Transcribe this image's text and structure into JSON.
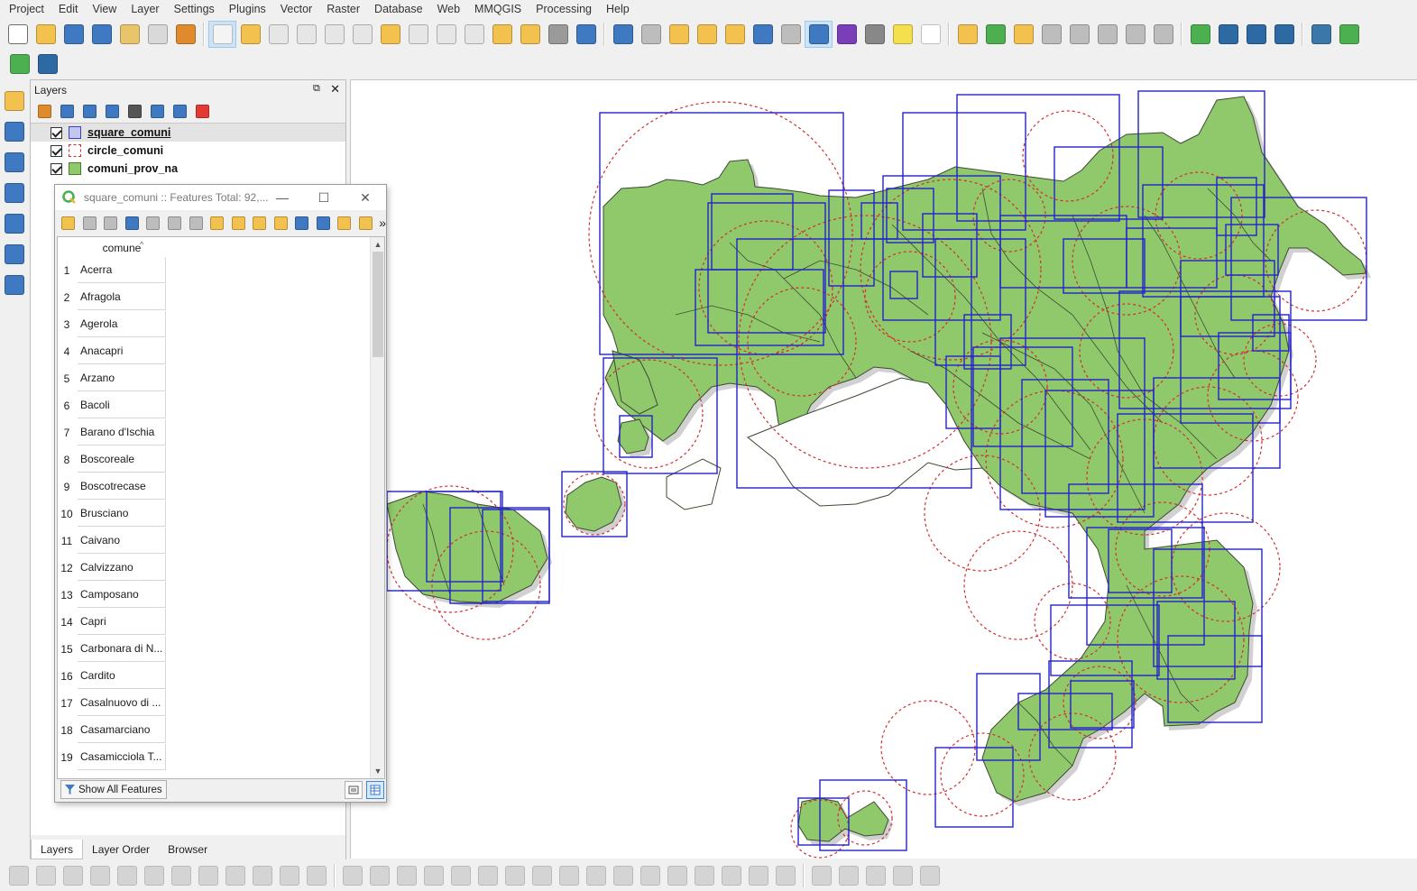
{
  "menubar": {
    "items": [
      "Project",
      "Edit",
      "View",
      "Layer",
      "Settings",
      "Plugins",
      "Vector",
      "Raster",
      "Database",
      "Web",
      "MMQGIS",
      "Processing",
      "Help"
    ]
  },
  "toolbar": {
    "icons": [
      {
        "name": "new-project-icon",
        "color": "#ffffff",
        "border": "#6d6d6d"
      },
      {
        "name": "open-project-icon",
        "color": "#f2c14e"
      },
      {
        "name": "save-project-icon",
        "color": "#3f79c2"
      },
      {
        "name": "save-as-icon",
        "color": "#3f79c2"
      },
      {
        "name": "new-print-layout-icon",
        "color": "#e9c46a"
      },
      {
        "name": "layout-manager-icon",
        "color": "#d9d9d9"
      },
      {
        "name": "style-manager-icon",
        "color": "#e08a2e"
      },
      {
        "sep": true
      },
      {
        "name": "pan-icon",
        "color": "#f4f4f4",
        "active": true
      },
      {
        "name": "pan-to-selection-icon",
        "color": "#f2c14e"
      },
      {
        "name": "zoom-in-icon",
        "color": "#e6e6e6"
      },
      {
        "name": "zoom-out-icon",
        "color": "#e6e6e6"
      },
      {
        "name": "zoom-native-icon",
        "color": "#e6e6e6"
      },
      {
        "name": "zoom-full-icon",
        "color": "#e6e6e6"
      },
      {
        "name": "zoom-to-selection-icon",
        "color": "#f2c14e"
      },
      {
        "name": "zoom-to-layer-icon",
        "color": "#e6e6e6"
      },
      {
        "name": "zoom-last-icon",
        "color": "#e6e6e6"
      },
      {
        "name": "zoom-next-icon",
        "color": "#e6e6e6"
      },
      {
        "name": "new-map-view-icon",
        "color": "#f2c14e"
      },
      {
        "name": "new-bookmark-icon",
        "color": "#f2c14e"
      },
      {
        "name": "show-bookmarks-icon",
        "color": "#9a9a9a"
      },
      {
        "name": "refresh-icon",
        "color": "#3f79c2"
      },
      {
        "sep": true
      },
      {
        "name": "identify-icon",
        "color": "#3f79c2"
      },
      {
        "name": "run-action-icon",
        "color": "#bdbdbd"
      },
      {
        "name": "select-features-icon",
        "color": "#f2c14e"
      },
      {
        "name": "select-by-value-icon",
        "color": "#f2c14e"
      },
      {
        "name": "deselect-all-icon",
        "color": "#f2c14e"
      },
      {
        "name": "open-attribute-table-icon",
        "color": "#3f79c2"
      },
      {
        "name": "field-calculator-icon",
        "color": "#bdbdbd"
      },
      {
        "name": "toolbox-icon",
        "color": "#3f79c2",
        "active": true
      },
      {
        "name": "statistical-summary-icon",
        "color": "#7a3fb8"
      },
      {
        "name": "measure-line-icon",
        "color": "#888888"
      },
      {
        "name": "map-tips-icon",
        "color": "#f4e04d"
      },
      {
        "name": "text-annotation-icon",
        "color": "#ffffff"
      },
      {
        "sep": true
      },
      {
        "name": "layer-labeling-icon",
        "color": "#f2c14e"
      },
      {
        "name": "layer-diagram-icon",
        "color": "#4caf50"
      },
      {
        "name": "highlight-pinned-labels-icon",
        "color": "#f2c14e"
      },
      {
        "name": "pin-label-icon",
        "color": "#bdbdbd"
      },
      {
        "name": "show-hide-labels-icon",
        "color": "#bdbdbd"
      },
      {
        "name": "move-label-icon",
        "color": "#bdbdbd"
      },
      {
        "name": "rotate-label-icon",
        "color": "#bdbdbd"
      },
      {
        "name": "change-label-icon",
        "color": "#bdbdbd"
      },
      {
        "sep": true
      },
      {
        "name": "geometry-checker-icon",
        "color": "#4caf50"
      },
      {
        "name": "quickmapservices-icon",
        "color": "#2d6aa3"
      },
      {
        "name": "web-search-icon",
        "color": "#2d6aa3"
      },
      {
        "name": "globe-cars-icon",
        "color": "#2d6aa3"
      },
      {
        "sep": true
      },
      {
        "name": "python-console-icon",
        "color": "#3b77a8"
      },
      {
        "name": "plugin-icon",
        "color": "#4caf50"
      }
    ]
  },
  "toolbar2": {
    "icons": [
      {
        "name": "search-locator-icon",
        "color": "#4caf50"
      },
      {
        "name": "processing-model-icon",
        "color": "#2d6aa3"
      }
    ]
  },
  "lefttools": {
    "icons": [
      {
        "name": "data-source-manager-icon",
        "color": "#f2c14e"
      },
      {
        "name": "add-vector-layer-icon",
        "color": "#3f79c2"
      },
      {
        "name": "digitize-icon",
        "color": "#3f79c2"
      },
      {
        "name": "add-delimited-text-icon",
        "color": "#3f79c2"
      },
      {
        "name": "add-raster-icon",
        "color": "#3f79c2"
      },
      {
        "name": "database-icon",
        "color": "#3f79c2"
      },
      {
        "name": "georeferencer-icon",
        "color": "#3f79c2"
      }
    ]
  },
  "layers_panel": {
    "title": "Layers",
    "float_glyph": "⧉",
    "close_glyph": "✕",
    "toolbar_icons": [
      {
        "name": "open-layer-styling-icon",
        "color": "#e08a2e"
      },
      {
        "name": "add-group-icon",
        "color": "#3f79c2"
      },
      {
        "name": "manage-map-themes-icon",
        "color": "#3f79c2"
      },
      {
        "name": "filter-legend-icon",
        "color": "#3f79c2"
      },
      {
        "name": "filter-by-expression-icon",
        "color": "#555555"
      },
      {
        "name": "expand-all-icon",
        "color": "#3f79c2"
      },
      {
        "name": "collapse-all-icon",
        "color": "#3f79c2"
      },
      {
        "name": "remove-layer-icon",
        "color": "#e53935"
      }
    ],
    "layers": [
      {
        "label": "square_comuni",
        "checked": true,
        "selected": true,
        "symbol": "square",
        "fill": "#c3c7e8",
        "stroke": "#3f3fc7"
      },
      {
        "label": "circle_comuni",
        "checked": true,
        "selected": false,
        "symbol": "dashed",
        "fill": "#ffffff",
        "stroke": "#d32f2f"
      },
      {
        "label": "comuni_prov_na",
        "checked": true,
        "selected": false,
        "symbol": "fill",
        "fill": "#8fc96b",
        "stroke": "#4a7c2b"
      }
    ],
    "tabs": [
      {
        "label": "Layers",
        "active": true
      },
      {
        "label": "Layer Order",
        "active": false
      },
      {
        "label": "Browser",
        "active": false
      }
    ]
  },
  "attribute_table": {
    "title": "square_comuni :: Features Total: 92,...",
    "minimize_glyph": "—",
    "maximize_glyph": "☐",
    "close_glyph": "✕",
    "toolbar_icons": [
      {
        "name": "toggle-editing-icon",
        "color": "#f2c14e"
      },
      {
        "name": "toggle-multi-edit-icon",
        "color": "#bdbdbd"
      },
      {
        "name": "save-edits-icon",
        "color": "#bdbdbd"
      },
      {
        "name": "reload-table-icon",
        "color": "#3f79c2"
      },
      {
        "name": "add-feature-icon",
        "color": "#bdbdbd"
      },
      {
        "name": "delete-selected-icon",
        "color": "#bdbdbd"
      },
      {
        "name": "cut-icon",
        "color": "#bdbdbd"
      },
      {
        "name": "select-by-expression-icon",
        "color": "#f2c14e"
      },
      {
        "name": "select-all-icon",
        "color": "#f2c14e"
      },
      {
        "name": "invert-selection-icon",
        "color": "#f2c14e"
      },
      {
        "name": "deselect-icon",
        "color": "#f2c14e"
      },
      {
        "name": "filter-select-icon",
        "color": "#3f79c2"
      },
      {
        "name": "move-selection-to-top-icon",
        "color": "#3f79c2"
      },
      {
        "name": "pan-map-to-selection-icon",
        "color": "#f2c14e"
      },
      {
        "name": "zoom-map-to-selection-icon",
        "color": "#f2c14e"
      }
    ],
    "more_glyph": "»",
    "column_header": "comune",
    "sort_glyph": "^",
    "rows": [
      {
        "n": "1",
        "comune": "Acerra"
      },
      {
        "n": "2",
        "comune": "Afragola"
      },
      {
        "n": "3",
        "comune": "Agerola"
      },
      {
        "n": "4",
        "comune": "Anacapri"
      },
      {
        "n": "5",
        "comune": "Arzano"
      },
      {
        "n": "6",
        "comune": "Bacoli"
      },
      {
        "n": "7",
        "comune": "Barano d'Ischia"
      },
      {
        "n": "8",
        "comune": "Boscoreale"
      },
      {
        "n": "9",
        "comune": "Boscotrecase"
      },
      {
        "n": "10",
        "comune": "Brusciano"
      },
      {
        "n": "11",
        "comune": "Caivano"
      },
      {
        "n": "12",
        "comune": "Calvizzano"
      },
      {
        "n": "13",
        "comune": "Camposano"
      },
      {
        "n": "14",
        "comune": "Capri"
      },
      {
        "n": "15",
        "comune": "Carbonara di N..."
      },
      {
        "n": "16",
        "comune": "Cardito"
      },
      {
        "n": "17",
        "comune": "Casalnuovo di ..."
      },
      {
        "n": "18",
        "comune": "Casamarciano"
      },
      {
        "n": "19",
        "comune": "Casamicciola T..."
      }
    ],
    "show_all_button": "Show All Features",
    "scroll_up_glyph": "▲",
    "scroll_down_glyph": "▼"
  },
  "bottom_toolbar": {
    "icons": [
      {
        "name": "current-edits-icon",
        "color": "#bdbdbd"
      },
      {
        "name": "toggle-edit-icon",
        "color": "#f2c14e"
      },
      {
        "name": "save-layer-edits-icon",
        "color": "#bdbdbd"
      },
      {
        "name": "add-record-icon",
        "color": "#bdbdbd"
      },
      {
        "name": "vertex-tool-icon",
        "color": "#bdbdbd"
      },
      {
        "name": "modify-attributes-icon",
        "color": "#bdbdbd"
      },
      {
        "name": "delete-selected-feature-icon",
        "color": "#bdbdbd"
      },
      {
        "name": "cut-features-icon",
        "color": "#bdbdbd"
      },
      {
        "name": "copy-features-icon",
        "color": "#bdbdbd"
      },
      {
        "name": "paste-features-icon",
        "color": "#bdbdbd"
      },
      {
        "name": "undo-icon",
        "color": "#bdbdbd"
      },
      {
        "name": "redo-icon",
        "color": "#bdbdbd"
      },
      {
        "sep": true
      },
      {
        "name": "digitize-with-segment-icon",
        "color": "#bdbdbd"
      },
      {
        "name": "move-feature-icon",
        "color": "#bdbdbd"
      },
      {
        "name": "rotate-feature-icon",
        "color": "#bdbdbd"
      },
      {
        "name": "simplify-feature-icon",
        "color": "#bdbdbd"
      },
      {
        "name": "add-ring-icon",
        "color": "#bdbdbd"
      },
      {
        "name": "add-part-icon",
        "color": "#bdbdbd"
      },
      {
        "name": "fill-ring-icon",
        "color": "#bdbdbd"
      },
      {
        "name": "delete-ring-icon",
        "color": "#bdbdbd"
      },
      {
        "name": "delete-part-icon",
        "color": "#bdbdbd"
      },
      {
        "name": "reshape-features-icon",
        "color": "#bdbdbd"
      },
      {
        "name": "offset-curve-icon",
        "color": "#bdbdbd"
      },
      {
        "name": "split-features-icon",
        "color": "#bdbdbd"
      },
      {
        "name": "split-parts-icon",
        "color": "#bdbdbd"
      },
      {
        "name": "merge-features-icon",
        "color": "#bdbdbd"
      },
      {
        "name": "merge-attributes-icon",
        "color": "#bdbdbd"
      },
      {
        "name": "rotate-point-symbols-icon",
        "color": "#bdbdbd"
      },
      {
        "name": "offset-point-symbols-icon",
        "color": "#bdbdbd"
      },
      {
        "sep": true
      },
      {
        "name": "shape-digitize-icon",
        "color": "#bdbdbd"
      },
      {
        "name": "circle-digitize-icon",
        "color": "#bdbdbd"
      },
      {
        "name": "ellipse-digitize-icon",
        "color": "#bdbdbd"
      },
      {
        "name": "rectangle-digitize-icon",
        "color": "#bdbdbd"
      },
      {
        "name": "regular-polygon-digitize-icon",
        "color": "#bdbdbd"
      }
    ]
  },
  "map": {
    "land_fill": "#8fc96b",
    "land_stroke": "#3d4a33",
    "square_stroke": "#2323c8",
    "circle_stroke": "#d32f2f",
    "background": "#ffffff"
  }
}
